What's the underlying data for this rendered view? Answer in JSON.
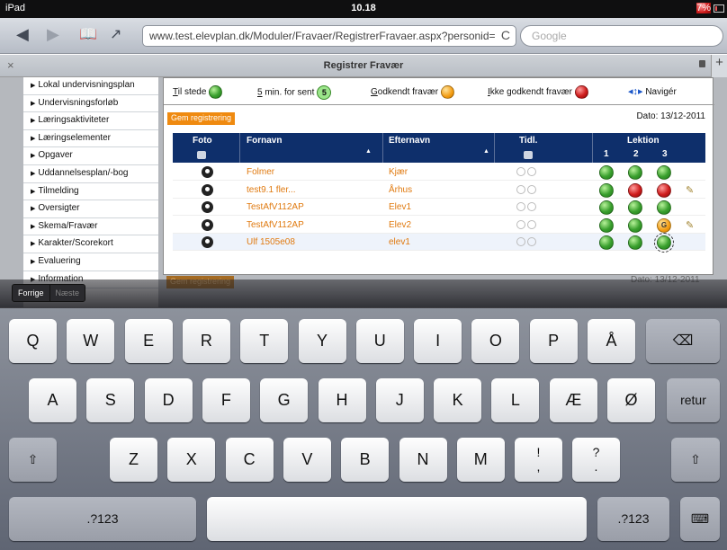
{
  "status": {
    "device": "iPad",
    "time": "10.18",
    "battery": "7%"
  },
  "browser": {
    "url": "www.test.elevplan.dk/Moduler/Fravaer/RegistrerFravaer.aspx?personid=",
    "search_placeholder": "Google",
    "reload": "C"
  },
  "page": {
    "title": "Registrer Fravær",
    "close": "×",
    "add": "+"
  },
  "sidebar": {
    "items": [
      "Lokal undervisningsplan",
      "Undervisningsforløb",
      "Læringsaktiviteter",
      "Læringselementer",
      "Opgaver",
      "Uddannelsesplan/-bog",
      "Tilmelding",
      "Oversigter",
      "Skema/Fravær",
      "Karakter/Scorekort",
      "Evaluering",
      "Information"
    ]
  },
  "legend": {
    "present_key": "T",
    "present_rest": "il stede",
    "late_key": "5",
    "late_rest": " min. for sent",
    "late_badge": "5",
    "approved_key": "G",
    "approved_rest": "odkendt fravær",
    "unapproved_key": "I",
    "unapproved_rest": "kke godkendt fravær",
    "navigate": "Navigér",
    "navigate_icon": "arrow-cross-icon"
  },
  "actions": {
    "save_label": "Gem registrering",
    "date": "Dato: 13/12-2011"
  },
  "table": {
    "col_photo": "Foto",
    "col_firstname": "Fornavn",
    "col_lastname": "Efternavn",
    "col_tidl": "Tidl.",
    "col_lesson": "Lektion",
    "lessons": [
      "1",
      "2",
      "3"
    ],
    "rows": [
      {
        "first": "Folmer",
        "last": "Kjær",
        "lessons": [
          "green",
          "green",
          "green"
        ],
        "edit": false
      },
      {
        "first": "test9.1 fler...",
        "last": "Århus",
        "lessons": [
          "green",
          "red",
          "red"
        ],
        "edit": true
      },
      {
        "first": "TestAfV112AP",
        "last": "Elev1",
        "lessons": [
          "green",
          "green",
          "green"
        ],
        "edit": false
      },
      {
        "first": "TestAfV112AP",
        "last": "Elev2",
        "lessons": [
          "green",
          "green",
          "orange"
        ],
        "edit": true,
        "badge": "G"
      },
      {
        "first": "Ulf 1505e08",
        "last": "elev1",
        "lessons": [
          "green",
          "green",
          "green"
        ],
        "edit": false
      }
    ]
  },
  "colors": {
    "green": "#3aa02e",
    "red": "#d01d1d",
    "orange": "#f39c12",
    "header": "#0e2f6b",
    "accent": "#ef8a10"
  },
  "form_assistant": {
    "prev": "Forrige",
    "next": "Næste"
  },
  "keyboard": {
    "row1": [
      "Q",
      "W",
      "E",
      "R",
      "T",
      "Y",
      "U",
      "I",
      "O",
      "P",
      "Å"
    ],
    "row2": [
      "A",
      "S",
      "D",
      "F",
      "G",
      "H",
      "J",
      "K",
      "L",
      "Æ",
      "Ø"
    ],
    "row3": [
      "Z",
      "X",
      "C",
      "V",
      "B",
      "N",
      "M"
    ],
    "return": "retur",
    "numbers": ".?123",
    "backspace": "backspace-icon",
    "shift": "shift-icon",
    "hide": "keyboard-hide-icon",
    "excl_top": "!",
    "excl_bottom": ",",
    "quest_top": "?",
    "quest_bottom": "."
  }
}
